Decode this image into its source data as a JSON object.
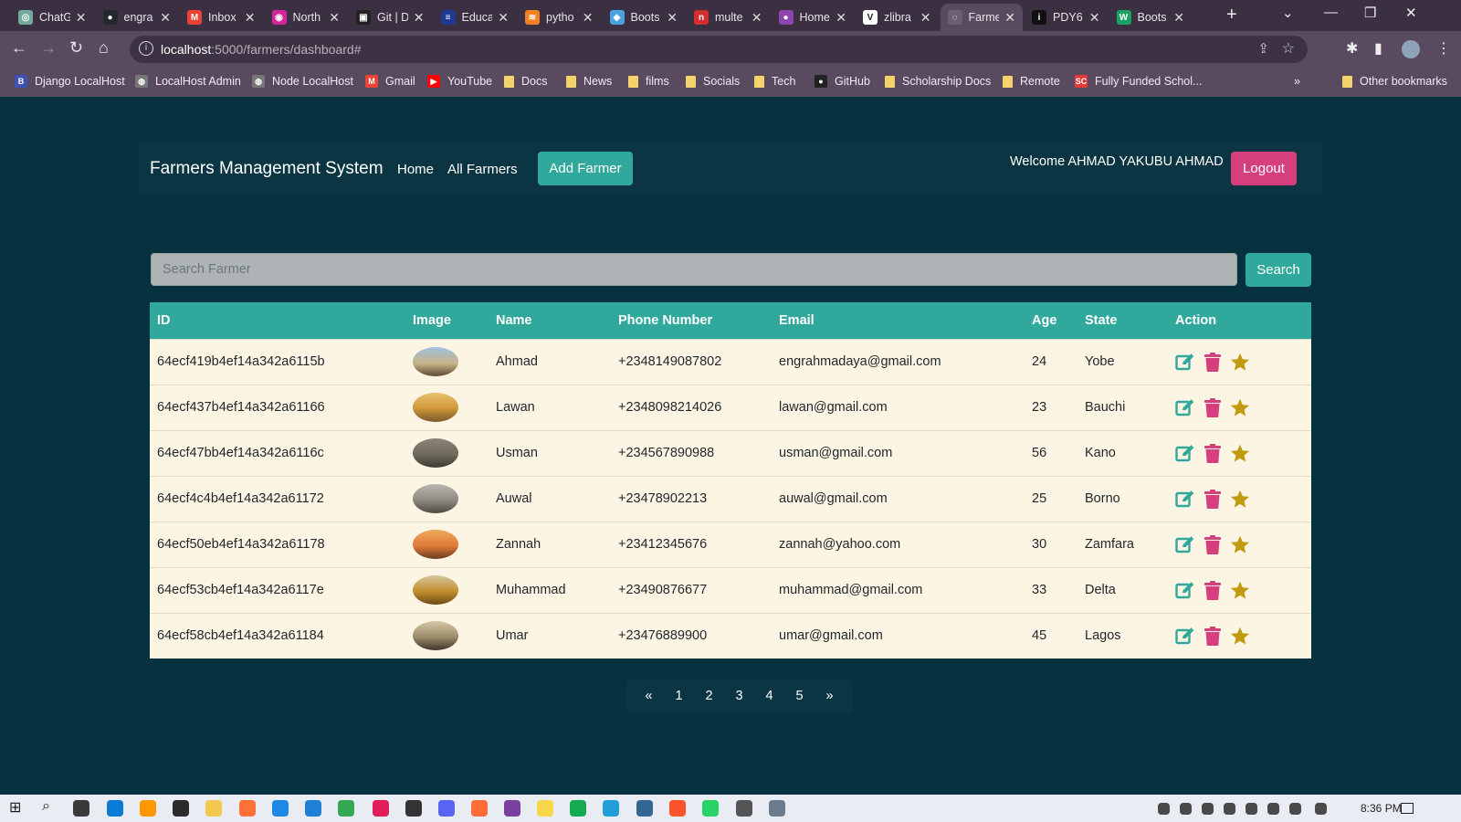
{
  "browser": {
    "tabs": [
      {
        "label": "ChatG",
        "color": "#74aa9c",
        "glyph": "◎"
      },
      {
        "label": "engra",
        "color": "#24292f",
        "glyph": "●"
      },
      {
        "label": "Inbox",
        "color": "#ea4335",
        "glyph": "M"
      },
      {
        "label": "North",
        "color": "#d6249f",
        "glyph": "◉"
      },
      {
        "label": "Git | D",
        "color": "#222222",
        "glyph": "▣"
      },
      {
        "label": "Educa",
        "color": "#1f3a93",
        "glyph": "≡"
      },
      {
        "label": "pytho",
        "color": "#f48024",
        "glyph": "≋"
      },
      {
        "label": "Boots",
        "color": "#4aa3df",
        "glyph": "◆"
      },
      {
        "label": "multe",
        "color": "#d32f2f",
        "glyph": "n"
      },
      {
        "label": "Home",
        "color": "#8e44ad",
        "glyph": "●"
      },
      {
        "label": "zlibra",
        "color": "#ffffff",
        "glyph": "V"
      },
      {
        "label": "Farme",
        "color": "#6d5f73",
        "glyph": "◌"
      },
      {
        "label": "PDY6",
        "color": "#111111",
        "glyph": "i"
      },
      {
        "label": "Boots",
        "color": "#1aa260",
        "glyph": "W"
      }
    ],
    "url_host": "localhost",
    "url_path": ":5000/farmers/dashboard#",
    "bookmarks": [
      {
        "label": "Django LocalHost",
        "kind": "B"
      },
      {
        "label": "LocalHost Admin",
        "kind": "globe"
      },
      {
        "label": "Node LocalHost",
        "kind": "globe"
      },
      {
        "label": "Gmail",
        "kind": "M"
      },
      {
        "label": "YouTube",
        "kind": "yt"
      },
      {
        "label": "Docs",
        "kind": "folder"
      },
      {
        "label": "News",
        "kind": "folder"
      },
      {
        "label": "films",
        "kind": "folder"
      },
      {
        "label": "Socials",
        "kind": "folder"
      },
      {
        "label": "Tech",
        "kind": "folder"
      },
      {
        "label": "GitHub",
        "kind": "gh"
      },
      {
        "label": "Scholarship Docs",
        "kind": "folder"
      },
      {
        "label": "Remote",
        "kind": "folder"
      },
      {
        "label": "Fully Funded Schol...",
        "kind": "sc"
      }
    ],
    "overflow": "»",
    "other_bookmarks": "Other bookmarks"
  },
  "navbar": {
    "brand": "Farmers Management System",
    "home": "Home",
    "all_farmers": "All Farmers",
    "add_farmer": "Add Farmer",
    "welcome": "Welcome AHMAD YAKUBU AHMAD",
    "logout": "Logout"
  },
  "search": {
    "placeholder": "Search Farmer",
    "button": "Search"
  },
  "table": {
    "headers": [
      "ID",
      "Image",
      "Name",
      "Phone Number",
      "Email",
      "Age",
      "State",
      "Action"
    ],
    "rows": [
      {
        "id": "64ecf419b4ef14a342a6115b",
        "name": "Ahmad",
        "phone": "+2348149087802",
        "email": "engrahmadaya@gmail.com",
        "age": "24",
        "state": "Yobe"
      },
      {
        "id": "64ecf437b4ef14a342a61166",
        "name": "Lawan",
        "phone": "+2348098214026",
        "email": "lawan@gmail.com",
        "age": "23",
        "state": "Bauchi"
      },
      {
        "id": "64ecf47bb4ef14a342a6116c",
        "name": "Usman",
        "phone": "+234567890988",
        "email": "usman@gmail.com",
        "age": "56",
        "state": "Kano"
      },
      {
        "id": "64ecf4c4b4ef14a342a61172",
        "name": "Auwal",
        "phone": "+23478902213",
        "email": "auwal@gmail.com",
        "age": "25",
        "state": "Borno"
      },
      {
        "id": "64ecf50eb4ef14a342a61178",
        "name": "Zannah",
        "phone": "+23412345676",
        "email": "zannah@yahoo.com",
        "age": "30",
        "state": "Zamfara"
      },
      {
        "id": "64ecf53cb4ef14a342a6117e",
        "name": "Muhammad",
        "phone": "+23490876677",
        "email": "muhammad@gmail.com",
        "age": "33",
        "state": "Delta"
      },
      {
        "id": "64ecf58cb4ef14a342a61184",
        "name": "Umar",
        "phone": "+23476889900",
        "email": "umar@gmail.com",
        "age": "45",
        "state": "Lagos"
      }
    ],
    "action_icons": [
      "edit-icon",
      "trash-icon",
      "star-icon"
    ],
    "colors": {
      "edit": "#31a89c",
      "delete": "#d63f7e",
      "star": "#c29a10"
    }
  },
  "pagination": {
    "prev": "«",
    "pages": [
      "1",
      "2",
      "3",
      "4",
      "5"
    ],
    "next": "»"
  },
  "taskbar": {
    "time": "8:36 PM"
  },
  "colors": {
    "page_bg": "#06313e",
    "navbar_bg": "#0b3543",
    "accent": "#31a89c",
    "logout": "#d63f7e",
    "row_bg": "#fdf5e4"
  }
}
